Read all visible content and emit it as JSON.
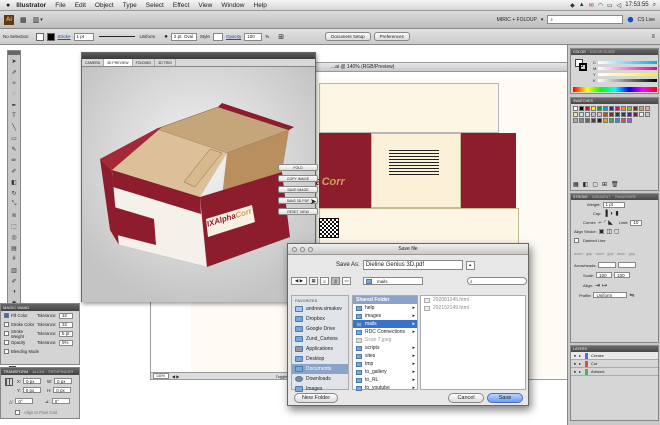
{
  "menubar": {
    "app": "Illustrator",
    "items": [
      "File",
      "Edit",
      "Object",
      "Type",
      "Select",
      "Effect",
      "View",
      "Window",
      "Help"
    ],
    "clock": "17:53:55",
    "user_icon": "magnifier-icon"
  },
  "appbar": {
    "logo": "Ai",
    "workspace": "MIRIC + FOLDUP",
    "workspace_arrow": "▾",
    "search_placeholder": "",
    "cs_live": "CS Live"
  },
  "control": {
    "selection": "No Selection",
    "stroke_label": "Stroke",
    "stroke_value": "1 pt",
    "uniform_label": "Uniform",
    "brush": "2 pt. Oval",
    "style_label": "Style",
    "opacity_label": "Opacity",
    "opacity_value": "100",
    "opacity_unit": "%",
    "document_setup": "Document Setup",
    "preferences": "Preferences"
  },
  "canvas": {
    "title": "...ai @ 140% (RGB/Preview)",
    "brand": "AlphaCorr",
    "brand_alpha": "Alpha",
    "brand_corr": "Corr",
    "brand_prefix": "IX",
    "zoom": "140%"
  },
  "statusbar": {
    "zoom": "140%",
    "toggle": "Toggle Selection"
  },
  "preview": {
    "tabs": [
      "CAMERA",
      "3D PREVIEW",
      "FOLDING",
      "3D TRIG"
    ],
    "active_tab": 1,
    "buttons": {
      "fold": "FOLD",
      "copy": "COPY IMAGE",
      "save_image": "SAVE IMAGE",
      "save_3d": "SAVE 3D PDF",
      "reset": "RESET VIEW"
    }
  },
  "magic_wand": {
    "title": "MAGIC WAND",
    "rows": [
      {
        "label": "Fill Color",
        "tol_label": "Tolerance:",
        "value": "32",
        "checked": true
      },
      {
        "label": "Stroke Color",
        "tol_label": "Tolerance:",
        "value": "32",
        "checked": false
      },
      {
        "label": "Stroke Weight",
        "tol_label": "Tolerance:",
        "value": "5 pt",
        "checked": false
      },
      {
        "label": "Opacity",
        "tol_label": "Tolerance:",
        "value": "5%",
        "checked": false
      },
      {
        "label": "Blending Mode",
        "tol_label": "",
        "value": "",
        "checked": false
      }
    ]
  },
  "transform": {
    "tabs": [
      "TRANSFORM",
      "ALIGN",
      "PATHFINDER"
    ],
    "x_label": "X:",
    "x_value": "0 px",
    "y_label": "Y:",
    "y_value": "0 px",
    "w_label": "W:",
    "w_value": "0 px",
    "h_label": "H:",
    "h_value": "0 px",
    "angle_label": "△:",
    "angle_value": "0°",
    "shear_label": "⊿:",
    "shear_value": "0°",
    "align_pixel": "Align to Pixel Grid"
  },
  "right": {
    "color_tabs": [
      "COLOR",
      "COLOR GUIDE"
    ],
    "color_channels": [
      "C",
      "M",
      "Y",
      "K"
    ],
    "swatches_title": "SWATCHES",
    "stroke_title": "STROKE",
    "stroke_tabs": [
      "STROKE",
      "GRADIENT",
      "TRANSPARE"
    ],
    "stroke_weight_label": "Weight:",
    "stroke_weight": "1 pt",
    "cap_label": "Cap:",
    "corner_label": "Corner:",
    "limit_label": "Limit:",
    "limit": "10",
    "align_stroke": "Align Stroke:",
    "dashed": "Dashed Line",
    "dash_labels": [
      "dash",
      "gap",
      "dash",
      "gap",
      "dash",
      "gap"
    ],
    "arrowheads": "Arrowheads:",
    "scale": "Scale:",
    "scale_values": [
      "100",
      "100"
    ],
    "align": "Align:",
    "profile": "Profile:",
    "profile_value": "Uniform",
    "layers_title": "LAYERS",
    "layers": [
      {
        "name": "Crease",
        "color": "#4b6ee0"
      },
      {
        "name": "Cut",
        "color": "#e04b4b"
      },
      {
        "name": "Artwork",
        "color": "#4bb84b"
      }
    ]
  },
  "save": {
    "title": "Save file",
    "save_as_label": "Save As:",
    "save_as_value": "Dieline Genius 3D.pdf",
    "location": "mails",
    "search_placeholder": "",
    "sidebar_header": "FAVORITES",
    "sidebar": [
      {
        "label": "andrew.simakov",
        "icon": "home-icon"
      },
      {
        "label": "Dropbox",
        "icon": "folder-icon"
      },
      {
        "label": "Google Drive",
        "icon": "folder-icon"
      },
      {
        "label": "Zund_Cartons",
        "icon": "folder-icon"
      },
      {
        "label": "Applications",
        "icon": "apps-icon"
      },
      {
        "label": "Desktop",
        "icon": "folder-icon"
      },
      {
        "label": "Documents",
        "icon": "folder-icon",
        "selected": true
      },
      {
        "label": "Downloads",
        "icon": "download-icon"
      },
      {
        "label": "Images",
        "icon": "folder-icon"
      }
    ],
    "col1": [
      {
        "label": "Shared Folder",
        "header": true
      },
      {
        "label": "help"
      },
      {
        "label": "images"
      },
      {
        "label": "mails",
        "selected": true
      },
      {
        "label": "RDC Connections"
      },
      {
        "label": "Scan 7.jpeg",
        "file": true
      },
      {
        "label": "scripts"
      },
      {
        "label": "sites"
      },
      {
        "label": "tmp"
      },
      {
        "label": "to_gallery"
      },
      {
        "label": "to_RL"
      },
      {
        "label": "to_youtube"
      }
    ],
    "col2": [
      "292081245.html",
      "292152149.html"
    ],
    "new_folder": "New Folder",
    "cancel": "Cancel",
    "save_btn": "Save"
  }
}
